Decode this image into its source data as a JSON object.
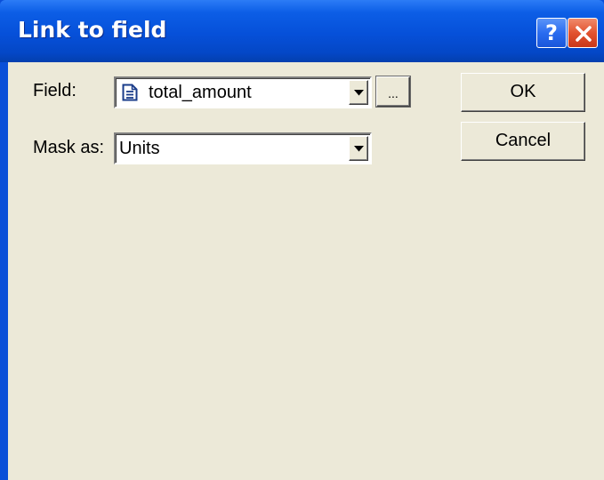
{
  "dialog": {
    "title": "Link to field"
  },
  "titlebar_buttons": {
    "help_label": "?",
    "close_icon": "close-icon"
  },
  "field": {
    "label": "Field:",
    "value": "total_amount",
    "icon": "document-icon",
    "browse_label": "..."
  },
  "mask": {
    "label": "Mask as:",
    "value": "Units"
  },
  "buttons": {
    "ok_label": "OK",
    "cancel_label": "Cancel"
  },
  "colors": {
    "titlebar": "#0a4fd8",
    "client_background": "#ece9d8",
    "close_button": "#e2532f"
  }
}
